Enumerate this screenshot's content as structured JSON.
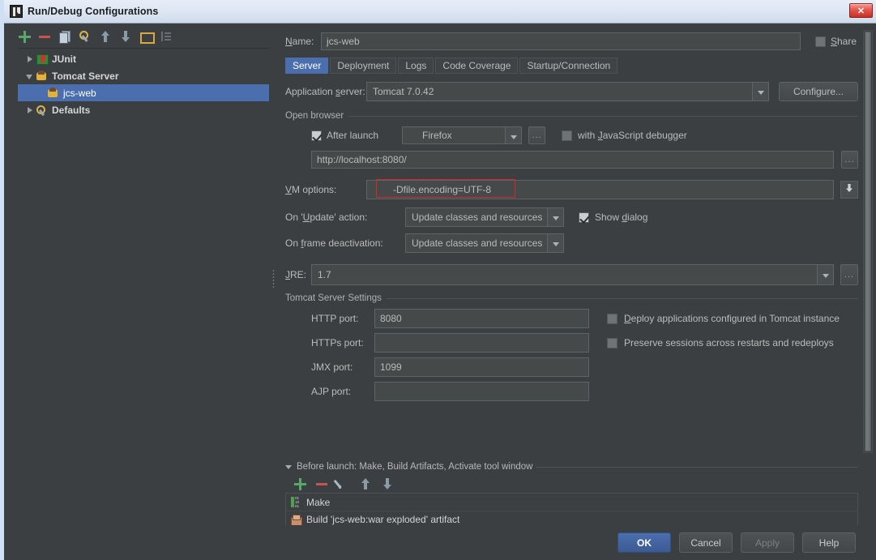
{
  "window": {
    "title": "Run/Debug Configurations",
    "app_icon": "intellij-idea-icon",
    "close_label": "✕"
  },
  "left_panel": {
    "toolbar": [
      {
        "name": "add-configuration-button",
        "icon": "plus-icon"
      },
      {
        "name": "remove-configuration-button",
        "icon": "minus-icon"
      },
      {
        "name": "copy-configuration-button",
        "icon": "copy-icon"
      },
      {
        "name": "edit-defaults-button",
        "icon": "wrench-icon"
      },
      {
        "name": "move-up-button",
        "icon": "arrow-up-icon"
      },
      {
        "name": "move-down-button",
        "icon": "arrow-down-icon"
      },
      {
        "name": "create-folder-button",
        "icon": "folder-icon"
      },
      {
        "name": "sort-configurations-button",
        "icon": "sort-icon"
      }
    ],
    "tree": [
      {
        "label": "JUnit",
        "icon": "junit-icon",
        "expanded": false,
        "selected": false,
        "child": false
      },
      {
        "label": "Tomcat Server",
        "icon": "tomcat-icon",
        "expanded": true,
        "selected": false,
        "child": false
      },
      {
        "label": "jcs-web",
        "icon": "tomcat-icon",
        "expanded": null,
        "selected": true,
        "child": true
      },
      {
        "label": "Defaults",
        "icon": "defaults-icon",
        "expanded": false,
        "selected": false,
        "child": false
      }
    ]
  },
  "form": {
    "name_label": "Name:",
    "name_value": "jcs-web",
    "share_label": "Share",
    "share_checked": false,
    "tabs": [
      {
        "label": "Server",
        "active": true
      },
      {
        "label": "Deployment",
        "active": false
      },
      {
        "label": "Logs",
        "active": false
      },
      {
        "label": "Code Coverage",
        "active": false
      },
      {
        "label": "Startup/Connection",
        "active": false
      }
    ],
    "application_server_label": "Application server:",
    "application_server_value": "Tomcat 7.0.42",
    "configure_label": "Configure...",
    "open_browser": {
      "group_title": "Open browser",
      "after_launch_label": "After launch",
      "after_launch_checked": true,
      "browser_value": "Firefox",
      "browser_icon": "firefox-icon",
      "browse_label": "...",
      "js_debugger_label": "with JavaScript debugger",
      "js_debugger_checked": false,
      "url_value": "http://localhost:8080/",
      "url_browse_label": "..."
    },
    "vm_options_label": "VM options:",
    "vm_options_value": "-Dfile.encoding=UTF-8",
    "vm_options_highlight_color": "#d02a2a",
    "vm_options_expand_icon": "expand-editor-icon",
    "on_update_label": "On 'Update' action:",
    "on_update_value": "Update classes and resources",
    "show_dialog_label": "Show dialog",
    "show_dialog_checked": true,
    "on_frame_deactivation_label": "On frame deactivation:",
    "on_frame_deactivation_value": "Update classes and resources",
    "jre_label": "JRE:",
    "jre_value": "1.7",
    "jre_browse_label": "...",
    "tomcat_settings": {
      "group_title": "Tomcat Server Settings",
      "ports": [
        {
          "label": "HTTP port:",
          "value": "8080"
        },
        {
          "label": "HTTPs port:",
          "value": ""
        },
        {
          "label": "JMX port:",
          "value": "1099"
        },
        {
          "label": "AJP port:",
          "value": ""
        }
      ],
      "checkboxes": [
        {
          "label": "Deploy applications configured in Tomcat instance",
          "checked": false
        },
        {
          "label": "Preserve sessions across restarts and redeploys",
          "checked": false
        }
      ]
    },
    "before_launch": {
      "title": "Before launch: Make, Build Artifacts, Activate tool window",
      "toolbar": [
        {
          "name": "add-task-button",
          "icon": "plus-icon"
        },
        {
          "name": "remove-task-button",
          "icon": "minus-icon"
        },
        {
          "name": "edit-task-button",
          "icon": "pencil-icon"
        },
        {
          "name": "move-task-up-button",
          "icon": "arrow-up-icon"
        },
        {
          "name": "move-task-down-button",
          "icon": "arrow-down-icon"
        }
      ],
      "items": [
        {
          "label": "Make",
          "icon": "make-icon"
        },
        {
          "label": "Build 'jcs-web:war exploded' artifact",
          "icon": "artifact-icon"
        }
      ]
    }
  },
  "buttons": {
    "ok": "OK",
    "cancel": "Cancel",
    "apply": "Apply",
    "help": "Help"
  }
}
